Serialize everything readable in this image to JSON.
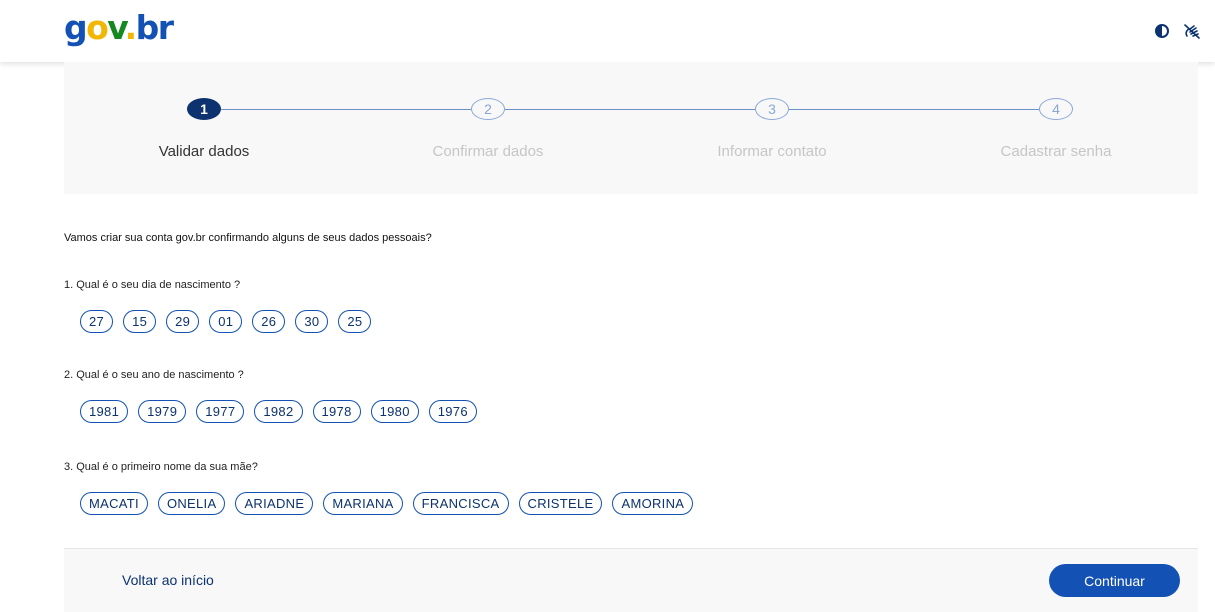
{
  "header": {
    "logo": {
      "g": "g",
      "o": "o",
      "v": "v",
      "dot": ".",
      "b": "b",
      "r": "r"
    },
    "icons": [
      "contrast-icon",
      "vlibras-icon"
    ]
  },
  "stepper": {
    "steps": [
      {
        "number": "1",
        "label": "Validar dados"
      },
      {
        "number": "2",
        "label": "Confirmar dados"
      },
      {
        "number": "3",
        "label": "Informar contato"
      },
      {
        "number": "4",
        "label": "Cadastrar senha"
      }
    ],
    "active_step": 1
  },
  "intro": "Vamos criar sua conta gov.br confirmando alguns de seus dados pessoais?",
  "questions": [
    {
      "text": "1. Qual é o seu dia de nascimento ?",
      "options": [
        "27",
        "15",
        "29",
        "01",
        "26",
        "30",
        "25"
      ]
    },
    {
      "text": "2. Qual é o seu ano de nascimento ?",
      "options": [
        "1981",
        "1979",
        "1977",
        "1982",
        "1978",
        "1980",
        "1976"
      ]
    },
    {
      "text": "3. Qual é o primeiro nome da sua mãe?",
      "options": [
        "MACATI",
        "ONELIA",
        "ARIADNE",
        "MARIANA",
        "FRANCISCA",
        "CRISTELE",
        "AMORINA"
      ]
    }
  ],
  "footer": {
    "back_label": "Voltar ao início",
    "continue_label": "Continuar"
  },
  "colors": {
    "primary": "#1351b4",
    "dark_blue": "#0c326f",
    "panel_bg": "#f8f8f8"
  }
}
